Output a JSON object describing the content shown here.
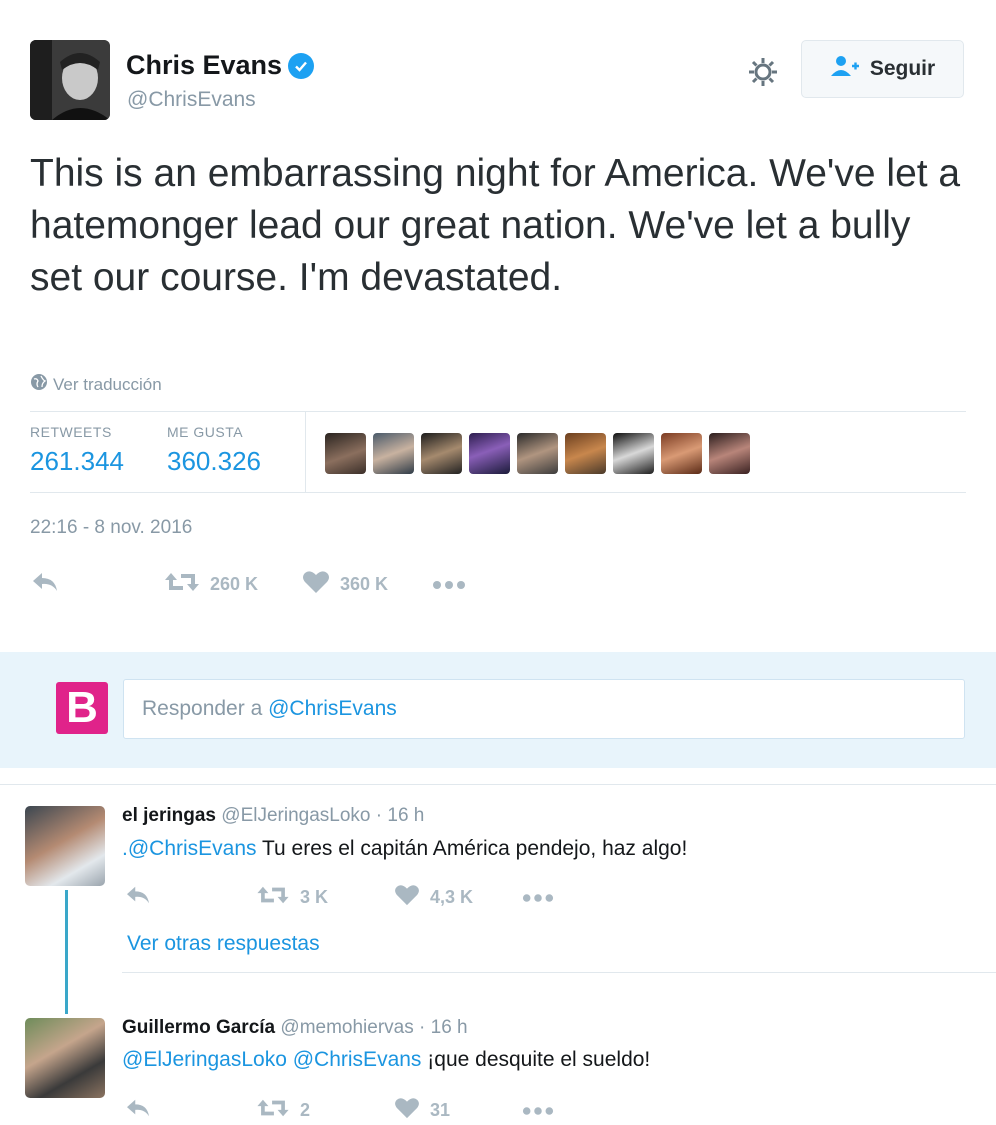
{
  "author": {
    "name": "Chris Evans",
    "handle": "@ChrisEvans",
    "verified_icon": "verified-badge-icon"
  },
  "header": {
    "follow_label": "Seguir",
    "follow_icon": "add-user-icon",
    "settings_icon": "gear-icon"
  },
  "tweet": {
    "text": "This is an embarrassing night for America. We've let a hatemonger lead our great nation. We've let a bully set our course. I'm devastated.",
    "translate_label": "Ver traducción",
    "stats": {
      "retweets_label": "RETWEETS",
      "retweets_value": "261.344",
      "likes_label": "ME GUSTA",
      "likes_value": "360.326"
    },
    "likers_count_shown": 9,
    "timestamp": "22:16 - 8 nov. 2016",
    "actions": {
      "retweet_count": "260 K",
      "like_count": "360 K"
    }
  },
  "reply_box": {
    "placeholder_prefix": "Responder a ",
    "placeholder_mention": "@ChrisEvans",
    "logo_letter": "B",
    "logo_color": "#e0238a"
  },
  "replies": [
    {
      "name": "el jeringas",
      "handle": "@ElJeringasLoko",
      "time": "· 16 h",
      "mention": ".@ChrisEvans",
      "text": " Tu eres el capitán América pendejo, haz algo!",
      "retweet_count": "3 K",
      "like_count": "4,3 K"
    },
    {
      "name": "Guillermo García",
      "handle": "@memohiervas",
      "time": "· 16 h",
      "mention": "@ElJeringasLoko @ChrisEvans",
      "text": " ¡que desquite el sueldo!",
      "retweet_count": "2",
      "like_count": "31"
    }
  ],
  "more_replies_label": "Ver otras respuestas",
  "colors": {
    "link": "#1b95e0",
    "muted": "#8899a6",
    "action_icon": "#aab8c2",
    "reply_band": "#e8f4fb",
    "thread_line": "#3aa7c9"
  }
}
